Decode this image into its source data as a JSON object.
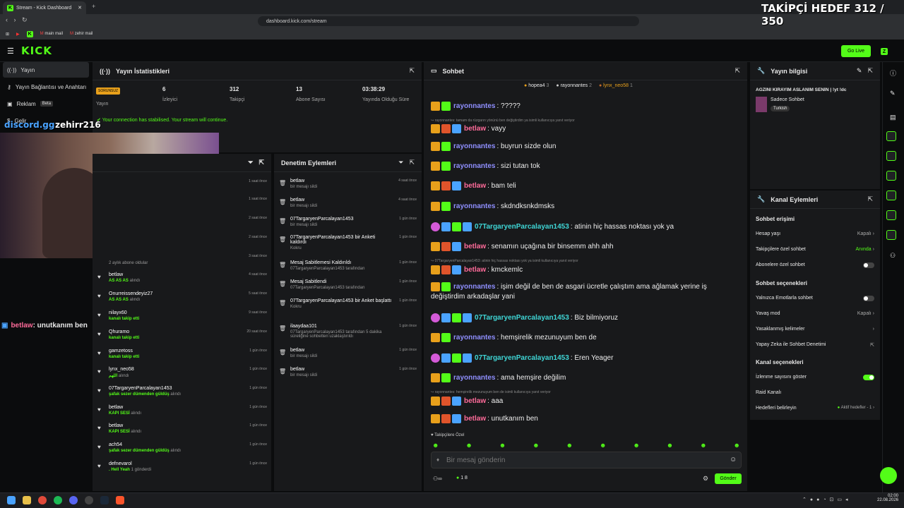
{
  "browser": {
    "tab_title": "Stream - Kick Dashboard",
    "url": "dashboard.kick.com/stream",
    "bookmarks": [
      "main mail",
      "zehir mail"
    ]
  },
  "overlay": {
    "goal": "TAKİPÇİ HEDEF 312 / 350",
    "discord": "discord.gg",
    "name": "zehirr216",
    "chat_overlay_user": "betlaw",
    "chat_overlay_msg": ": unutkanım ben"
  },
  "nav": {
    "go_live": "Go Live",
    "items": [
      {
        "label": "Yayın"
      },
      {
        "label": "Yayın Bağlantısı ve Anahtarı"
      },
      {
        "label": "Reklam",
        "badge": "Beta"
      },
      {
        "label": "Gelir"
      }
    ]
  },
  "stats": {
    "title": "Yayın İstatistikleri",
    "status": "SORUNSUZ",
    "status_label": "Yayın",
    "viewers": "6",
    "viewers_label": "İzleyici",
    "followers": "312",
    "followers_label": "Takipçi",
    "subs": "13",
    "subs_label": "Abone Sayısı",
    "uptime": "03:38:29",
    "uptime_label": "Yayında Olduğu Süre",
    "notice": "Your connection has stabilised. Your stream will continue."
  },
  "activity": {
    "rows": [
      {
        "t": "1 saat önce"
      },
      {
        "t": "1 saat önce"
      },
      {
        "t": "2 saat önce"
      },
      {
        "t": "2 saat önce"
      },
      {
        "t": "3 saat önce",
        "sub": "2 aylık abone oldular"
      },
      {
        "n": "betlaw",
        "s": "AS AS AS",
        "s2": "alındı",
        "t": "4 saat önce"
      },
      {
        "n": "Onurreissendeyiz27",
        "s": "AS AS AS",
        "s2": "alındı",
        "t": "5 saat önce"
      },
      {
        "n": "nilayx60",
        "s": "kanalı takip etti",
        "t": "9 saat önce"
      },
      {
        "n": "Qhuramo",
        "s": "kanalı takip etti",
        "t": "20 saat önce"
      },
      {
        "n": "gamzetoss",
        "s": "kanalı takip etti",
        "t": "1 gün önce"
      },
      {
        "n": "lynx_neo58",
        "s": "اللهم",
        "s2": "alındı",
        "t": "1 gün önce"
      },
      {
        "n": "07TargaryenParcalayan1453",
        "s": "şafak sezer dümenden güldüş",
        "s2": "alındı",
        "t": "1 gün önce"
      },
      {
        "n": "betlaw",
        "s": "KAPI SESİ",
        "s2": "alındı",
        "t": "1 gün önce"
      },
      {
        "n": "betlaw",
        "s": "KAPI SESİ",
        "s2": "alındı",
        "t": "1 gün önce"
      },
      {
        "n": "ach54",
        "s": "şafak sezer dümenden güldüş",
        "s2": "alındı",
        "t": "1 gün önce"
      },
      {
        "n": "defnevarol",
        "s": ". Hell Yeah",
        "s2": "1",
        "s3": "gönderdi",
        "t": "1 gün önce"
      }
    ]
  },
  "moderation": {
    "title": "Denetim Eylemleri",
    "rows": [
      {
        "n": "betlaw",
        "s": "bir mesajı sildi",
        "t": "4 saat önce"
      },
      {
        "n": "betlaw",
        "s": "bir mesajı sildi",
        "t": "4 saat önce"
      },
      {
        "n": "07TargaryenParcalayan1453",
        "s": "bir mesajı sildi",
        "t": "1 gün önce"
      },
      {
        "n": "07TargaryenParcalayan1453 bir Anketi kaldırdı",
        "s": "Kokru",
        "t": "1 gün önce"
      },
      {
        "n": "Mesaj Sabitlemesi Kaldırıldı",
        "s": "07TargaryenParcalayan1453 tarafından",
        "t": "1 gün önce"
      },
      {
        "n": "Mesaj Sabitlendi",
        "s": "07TargaryenParcalayan1453 tarafından",
        "t": "1 gün önce"
      },
      {
        "n": "07TargaryenParcalayan1453 bir Anket başlattı",
        "s": "Kokru",
        "t": "1 gün önce"
      },
      {
        "n": "ilaaydaa101",
        "s": "07TargaryenParcalayan1453 tarafından 5 dakika süreliğine sohbetten uzaklaştırıldı",
        "t": "1 gün önce"
      },
      {
        "n": "betlaw",
        "s": "bir mesajı sildi",
        "t": "1 gün önce"
      },
      {
        "n": "betlaw",
        "s": "bir mesajı sildi",
        "t": "1 gün önce"
      }
    ]
  },
  "chat": {
    "title": "Sohbet",
    "top": [
      {
        "n": "hopea4",
        "c": "3"
      },
      {
        "n": "rayonnantes",
        "c": "2"
      },
      {
        "n": "lynx_neo58",
        "c": "1"
      }
    ],
    "lines": [
      {
        "u": "rayonnantes",
        "m": ": ?????",
        "c": "#8f8fff"
      },
      {
        "sys": "rayonnantes: tamam da rüzgarın yönünü ben değiştirdim ya isimli kullanıcıya yanıt veriyor"
      },
      {
        "u": "betlaw",
        "m": ": vayy",
        "c": "#ff6b9a"
      },
      {
        "u": "rayonnantes",
        "m": ": buyrun sizde olun",
        "c": "#8f8fff"
      },
      {
        "u": "rayonnantes",
        "m": ": sizi tutan tok",
        "c": "#8f8fff"
      },
      {
        "u": "betlaw",
        "m": ": bam teli",
        "c": "#ff6b9a"
      },
      {
        "u": "rayonnantes",
        "m": ": skdndksnkdmsks",
        "c": "#8f8fff"
      },
      {
        "u": "07TargaryenParcalayan1453",
        "m": ": atinin hiç hassas noktası yok ya",
        "c": "#3fd6d6"
      },
      {
        "u": "betlaw",
        "m": ": senamın uçağına bir binsemm ahh ahh",
        "c": "#ff6b9a"
      },
      {
        "sys": "07TargaryenParcalayan1453: atinin hiç hassas noktası yok ya isimli kullanıcıya yanıt veriyor"
      },
      {
        "u": "betlaw",
        "m": ": kmckemlc",
        "c": "#ff6b9a"
      },
      {
        "u": "rayonnantes",
        "m": ": işim değil de ben de asgari ücretle çalıştım ama ağlamak yerine iş",
        "m2": "değiştirdim arkadaşlar yani",
        "c": "#8f8fff"
      },
      {
        "u": "07TargaryenParcalayan1453",
        "m": ": Biz bilmiyoruz",
        "c": "#3fd6d6"
      },
      {
        "u": "rayonnantes",
        "m": ": hemşirelik mezunuyum ben de",
        "c": "#8f8fff"
      },
      {
        "u": "07TargaryenParcalayan1453",
        "m": ": Eren Yeager",
        "c": "#3fd6d6"
      },
      {
        "u": "rayonnantes",
        "m": ": ama hemşire değilim",
        "c": "#8f8fff"
      },
      {
        "sys": "rayonnantes: hemşirelik mezunuyum ben de isimli kullanıcıya yanıt veriyor"
      },
      {
        "u": "betlaw",
        "m": ": aaa",
        "c": "#ff6b9a"
      },
      {
        "u": "betlaw",
        "m": ": unutkanım ben",
        "c": "#ff6b9a"
      }
    ],
    "followers_only": "Takipçilere Özel",
    "placeholder": "Bir mesaj gönderin",
    "send": "Gönder",
    "count": "1 8"
  },
  "info": {
    "title": "Yayın bilgisi",
    "stream_title": "AĞZINI KIRAYIM ASLANIM SENİN | !yt !dc",
    "category": "Sadece Sohbet",
    "tag": "Turkish"
  },
  "actions": {
    "title": "Kanal Eylemleri",
    "chat_access": "Sohbet erişimi",
    "account_age": "Hesap yaşı",
    "account_age_v": "Kapalı",
    "followers_chat": "Takipçilere özel sohbet",
    "followers_chat_v": "Anında",
    "subs_chat": "Abonelere özel sohbet",
    "chat_options": "Sohbet seçenekleri",
    "emote_only": "Yalnızca Emotlarla sohbet",
    "slow": "Yavaş mod",
    "slow_v": "Kapalı",
    "banned": "Yasaklanmış kelimeler",
    "ai": "Yapay Zeka ile Sohbet Denetimi",
    "channel_options": "Kanal seçenekleri",
    "show_viewers": "İzlenme sayısını göster",
    "raid": "Raid Kanalı",
    "goals": "Hedefleri belirleyin",
    "goals_v": "Aktif hedefler - 1"
  },
  "taskbar": {
    "time": "02:00",
    "date": "22.08.2026"
  }
}
